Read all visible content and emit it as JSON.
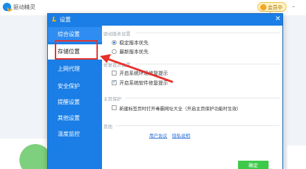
{
  "background_app": {
    "title": "驱动精灵",
    "vip_label": "会员中心"
  },
  "dialog": {
    "title": "设置",
    "close": "✕",
    "ok_label": "确定"
  },
  "sidebar": {
    "items": [
      {
        "label": "综合设置",
        "state": "active"
      },
      {
        "label": "存储位置",
        "state": "selected"
      },
      {
        "label": "上网代理",
        "state": "normal"
      },
      {
        "label": "安全保护",
        "state": "normal"
      },
      {
        "label": "提醒设置",
        "state": "normal"
      },
      {
        "label": "其他设置",
        "state": "normal"
      },
      {
        "label": "温度监控",
        "state": "normal"
      }
    ]
  },
  "sections": {
    "driver_version": {
      "title": "驱动版本设置",
      "options": [
        {
          "label": "稳定版本优先",
          "checked": true
        },
        {
          "label": "最新版本优先",
          "checked": false
        }
      ]
    },
    "repair_tip": {
      "title": "修复提示设置",
      "options": [
        {
          "label": "开启系统环境修复提示",
          "checked": false
        },
        {
          "label": "开启系统软件修复提示",
          "checked": true
        }
      ]
    },
    "homepage": {
      "title": "主页保护",
      "options": [
        {
          "label": "新建标签页时打开毒霸网址大全（开启主页保护功能时生效）",
          "checked": false
        }
      ]
    },
    "other": {
      "title": "其他",
      "links": [
        "用户协议",
        "隐私说明"
      ]
    }
  },
  "colors": {
    "header_blue": "#1a7ee6",
    "highlight_red": "#e8302a",
    "ok_green": "#3fc94a"
  }
}
